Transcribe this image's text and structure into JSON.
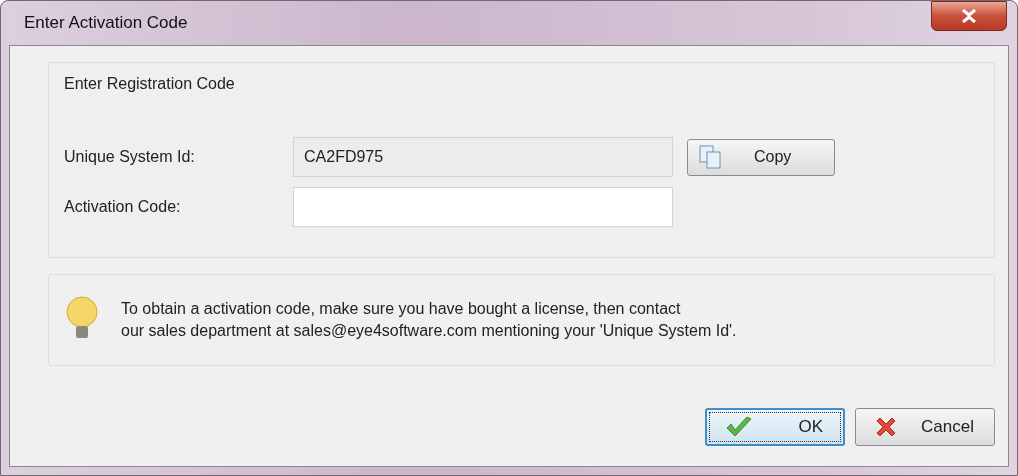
{
  "window": {
    "title": "Enter Activation Code"
  },
  "group": {
    "title": "Enter Registration Code",
    "fields": [
      {
        "label": "Unique System Id:",
        "value": "CA2FD975",
        "readonly": true
      },
      {
        "label": "Activation Code:",
        "readonly": false
      }
    ],
    "copy_button": "Copy"
  },
  "hint": {
    "lines": [
      "To obtain a activation code, make sure you have bought a license, then contact",
      "our sales department at sales@eye4software.com mentioning your 'Unique System Id'."
    ]
  },
  "buttons": [
    {
      "label": "OK",
      "kind": "ok",
      "focused": true
    },
    {
      "label": "Cancel",
      "kind": "cancel",
      "focused": false
    }
  ]
}
